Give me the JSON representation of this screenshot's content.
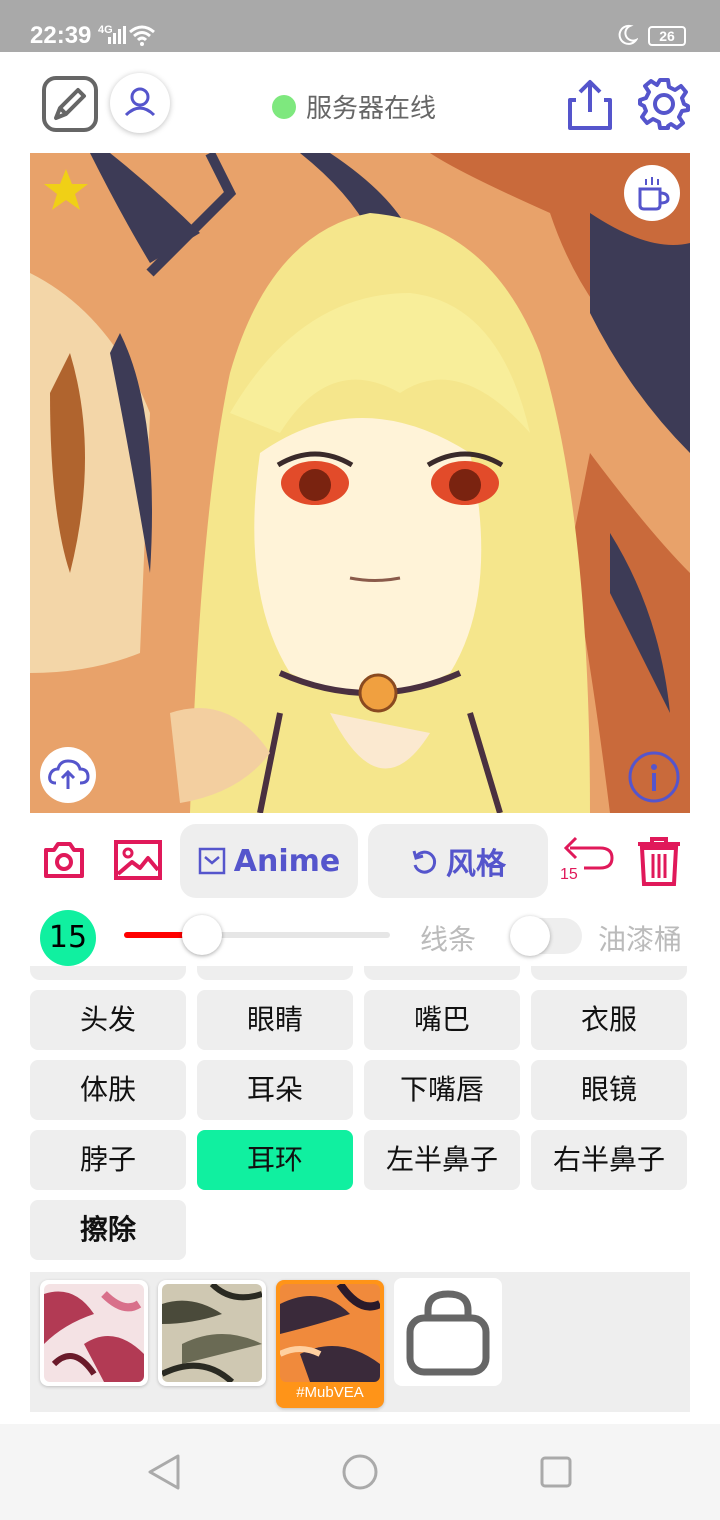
{
  "status_bar": {
    "time": "22:39",
    "network": "4G",
    "battery": "26"
  },
  "header": {
    "server_status": "服务器在线",
    "colors": {
      "online_dot": "#7ee87e",
      "accent": "#5555cc"
    }
  },
  "toolbar": {
    "anime_label": "Anime",
    "style_label": "风格",
    "undo_count": "15"
  },
  "brush": {
    "size": "15",
    "slider_value_fraction": 0.3,
    "line_label": "线条",
    "bucket_label": "油漆桶",
    "bucket_enabled": false
  },
  "parts": [
    {
      "label": "头发",
      "active": false
    },
    {
      "label": "眼睛",
      "active": false
    },
    {
      "label": "嘴巴",
      "active": false
    },
    {
      "label": "衣服",
      "active": false
    },
    {
      "label": "体肤",
      "active": false
    },
    {
      "label": "耳朵",
      "active": false
    },
    {
      "label": "下嘴唇",
      "active": false
    },
    {
      "label": "眼镜",
      "active": false
    },
    {
      "label": "脖子",
      "active": false
    },
    {
      "label": "耳环",
      "active": true
    },
    {
      "label": "左半鼻子",
      "active": false
    },
    {
      "label": "右半鼻子",
      "active": false
    },
    {
      "label": "擦除",
      "active": false
    }
  ],
  "styles": {
    "selected_tag": "#MubVEA"
  },
  "icons": [
    "edit-icon",
    "user-icon",
    "share-icon",
    "gear-icon",
    "star-icon",
    "coffee-icon",
    "upload-icon",
    "info-icon",
    "camera-icon",
    "image-icon",
    "checkbox-icon",
    "undo-icon",
    "trash-icon",
    "bag-icon",
    "back-icon",
    "home-icon",
    "recents-icon"
  ]
}
